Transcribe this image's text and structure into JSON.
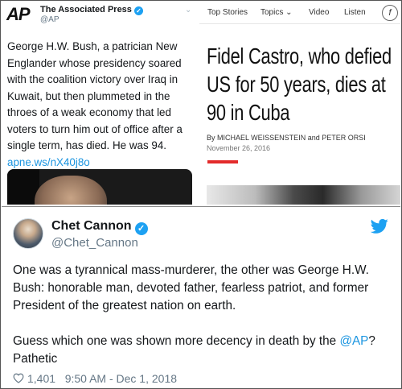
{
  "ap_tweet": {
    "logo": "AP",
    "name": "The Associated Press",
    "handle": "@AP",
    "text": "George H.W. Bush, a patrician New Englander whose presidency soared with the coalition victory over Iraq in Kuwait, but then plummeted in the throes of a weak economy that led voters to turn him out of office after a single term, has died. He was 94.",
    "link": "apne.ws/nX40j8o"
  },
  "article": {
    "nav": [
      "Top Stories",
      "Topics",
      "Video",
      "Listen"
    ],
    "nav_badge": "f",
    "headline": "Fidel Castro, who defied US for 50 years, dies at 90 in Cuba",
    "byline": "By MICHAEL WEISSENSTEIN and PETER ORSI",
    "date": "November 26, 2016",
    "accent_color": "#e32b2b"
  },
  "tweet": {
    "name": "Chet Cannon",
    "handle": "@Chet_Cannon",
    "paragraph1": "One was a tyrannical mass-murderer, the other was George H.W. Bush: honorable man, devoted father, fearless patriot, and former President of the greatest nation on earth.",
    "paragraph2_prefix": "Guess which one was shown more decency in death by the ",
    "mention": "@AP",
    "paragraph2_suffix": "? Pathetic",
    "likes": "1,401",
    "timestamp": "9:50 AM - Dec 1, 2018",
    "link_color": "#1b95e0"
  }
}
